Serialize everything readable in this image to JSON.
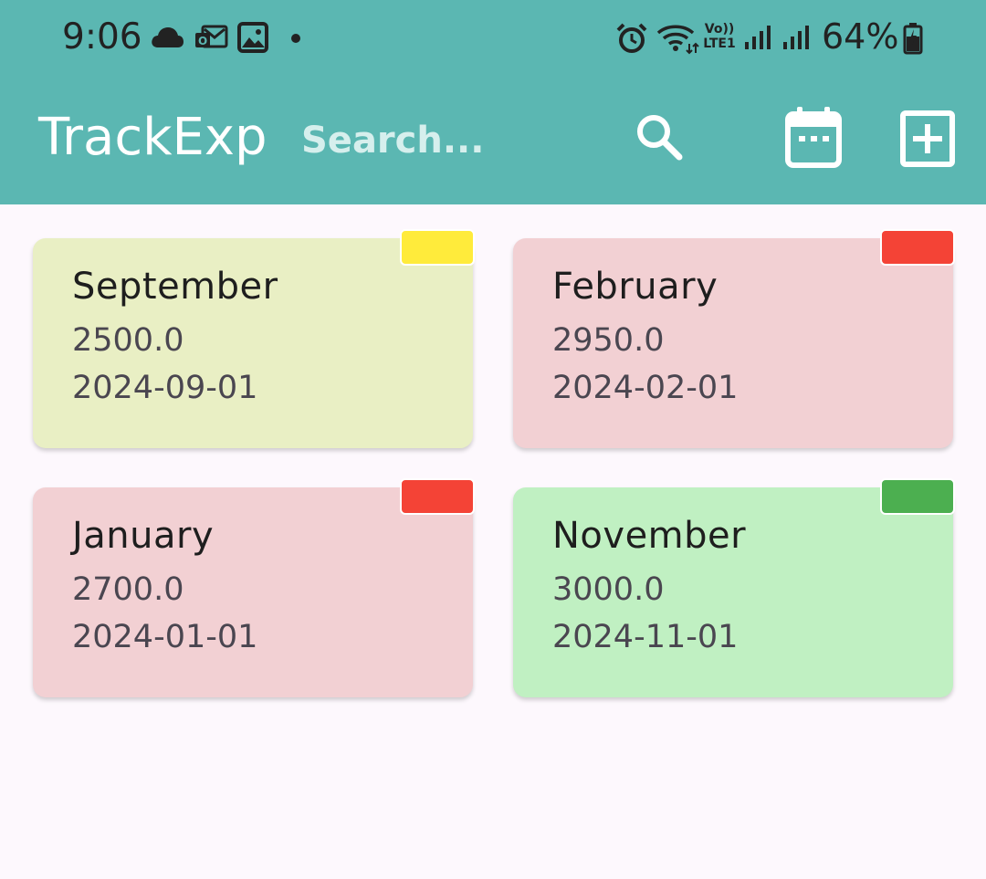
{
  "status_bar": {
    "time": "9:06",
    "battery": "64%",
    "icons": [
      "cloud-icon",
      "mail-icon",
      "image-icon",
      "dot-icon",
      "alarm-icon",
      "wifi-icon",
      "volte-icon",
      "signal-icon",
      "signal-icon",
      "battery-icon"
    ],
    "volte_line1": "Vo))",
    "volte_line2": "LTE1"
  },
  "app_bar": {
    "title": "TrackExp",
    "search_placeholder": "Search...",
    "background": "#5bb7b2"
  },
  "cards": [
    {
      "month": "September",
      "amount": "2500.0",
      "date": "2024-09-01",
      "background": "#e9efc4",
      "flag_color": "#ffeb3b"
    },
    {
      "month": "February",
      "amount": "2950.0",
      "date": "2024-02-01",
      "background": "#f2d0d3",
      "flag_color": "#f44336"
    },
    {
      "month": "January",
      "amount": "2700.0",
      "date": "2024-01-01",
      "background": "#f2d0d3",
      "flag_color": "#f44336"
    },
    {
      "month": "November",
      "amount": "3000.0",
      "date": "2024-11-01",
      "background": "#c0f0c2",
      "flag_color": "#4caf50"
    }
  ]
}
